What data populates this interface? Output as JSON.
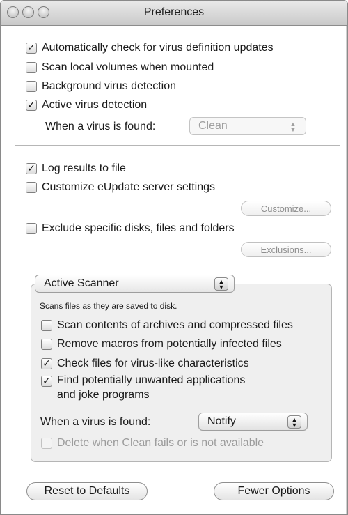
{
  "window": {
    "title": "Preferences"
  },
  "general": {
    "auto_update": {
      "label": "Automatically check for virus definition updates",
      "checked": true
    },
    "scan_volumes": {
      "label": "Scan local volumes when mounted",
      "checked": false
    },
    "background_detection": {
      "label": "Background virus detection",
      "checked": false
    },
    "active_detection": {
      "label": "Active virus detection",
      "checked": true
    },
    "when_found_label": "When a virus is found:",
    "when_found_value": "Clean"
  },
  "logging": {
    "log_results": {
      "label": "Log results to file",
      "checked": true
    },
    "customize_eupdate": {
      "label": "Customize eUpdate server settings",
      "checked": false
    },
    "customize_button": "Customize...",
    "exclude": {
      "label": "Exclude specific disks, files and folders",
      "checked": false
    },
    "exclusions_button": "Exclusions..."
  },
  "scanner": {
    "selected": "Active Scanner",
    "caption": "Scans files as they are saved to disk.",
    "archives": {
      "label": "Scan contents of archives and compressed files",
      "checked": false
    },
    "macros": {
      "label": "Remove macros from potentially infected files",
      "checked": false
    },
    "virus_like": {
      "label": "Check files for virus-like characteristics",
      "checked": true
    },
    "unwanted": {
      "label_line1": "Find potentially unwanted applications",
      "label_line2": "and joke programs",
      "checked": true
    },
    "when_found_label": "When a virus is found:",
    "when_found_value": "Notify",
    "delete_when_fail": {
      "label": "Delete when Clean fails or is not available",
      "checked": false
    }
  },
  "footer": {
    "reset_button": "Reset to Defaults",
    "fewer_button": "Fewer Options"
  }
}
